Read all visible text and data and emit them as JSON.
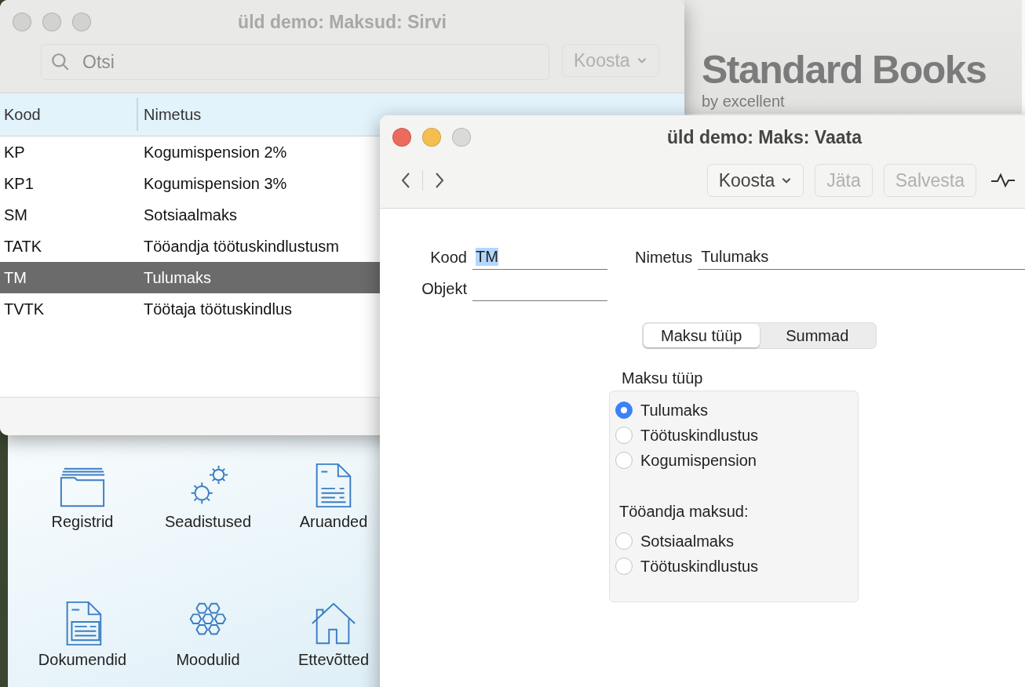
{
  "desktop": {
    "logo": {
      "title": "Standard Books",
      "subtitle": "by excellent"
    },
    "launcher": [
      {
        "label": "Registrid",
        "kind": "folder"
      },
      {
        "label": "Seadistused",
        "kind": "gears"
      },
      {
        "label": "Aruanded",
        "kind": "report"
      },
      {
        "label": "Dokumendid",
        "kind": "document"
      },
      {
        "label": "Moodulid",
        "kind": "modules"
      },
      {
        "label": "Ettevõtted",
        "kind": "house"
      }
    ]
  },
  "browse_window": {
    "title": "üld demo: Maksud: Sirvi",
    "active": false,
    "search": {
      "placeholder": "Otsi"
    },
    "menu_button": "Koosta",
    "columns": [
      "Kood",
      "Nimetus"
    ],
    "rows": [
      {
        "code": "KP",
        "name": "Kogumispension 2%",
        "selected": false
      },
      {
        "code": "KP1",
        "name": "Kogumispension 3%",
        "selected": false
      },
      {
        "code": "SM",
        "name": "Sotsiaalmaks",
        "selected": false
      },
      {
        "code": "TATK",
        "name": "Tööandja töötuskindlustusm",
        "selected": false
      },
      {
        "code": "TM",
        "name": "Tulumaks",
        "selected": true
      },
      {
        "code": "TVTK",
        "name": "Töötaja töötuskindlus",
        "selected": false
      }
    ]
  },
  "record_window": {
    "title": "üld demo: Maks: Vaata",
    "active": true,
    "menu_button": "Koosta",
    "buttons": [
      {
        "label": "Jäta",
        "disabled": true
      },
      {
        "label": "Salvesta",
        "disabled": true
      }
    ],
    "fields": {
      "code": {
        "label": "Kood",
        "value": "TM",
        "highlighted": true
      },
      "name": {
        "label": "Nimetus",
        "value": "Tulumaks",
        "highlighted": false
      },
      "object": {
        "label": "Objekt"
      }
    },
    "tabs": [
      {
        "label": "Maksu tüüp",
        "selected": true
      },
      {
        "label": "Summad",
        "selected": false
      }
    ],
    "tax_type": {
      "title": "Maksu tüüp",
      "groups": [
        {
          "options": [
            {
              "label": "Tulumaks",
              "selected": true
            },
            {
              "label": "Töötuskindlustus",
              "selected": false
            },
            {
              "label": "Kogumispension",
              "selected": false
            }
          ]
        },
        {
          "heading": "Tööandja maksud:",
          "options": [
            {
              "label": "Sotsiaalmaks",
              "selected": false
            },
            {
              "label": "Töötuskindlustus",
              "selected": false
            }
          ]
        }
      ]
    }
  }
}
